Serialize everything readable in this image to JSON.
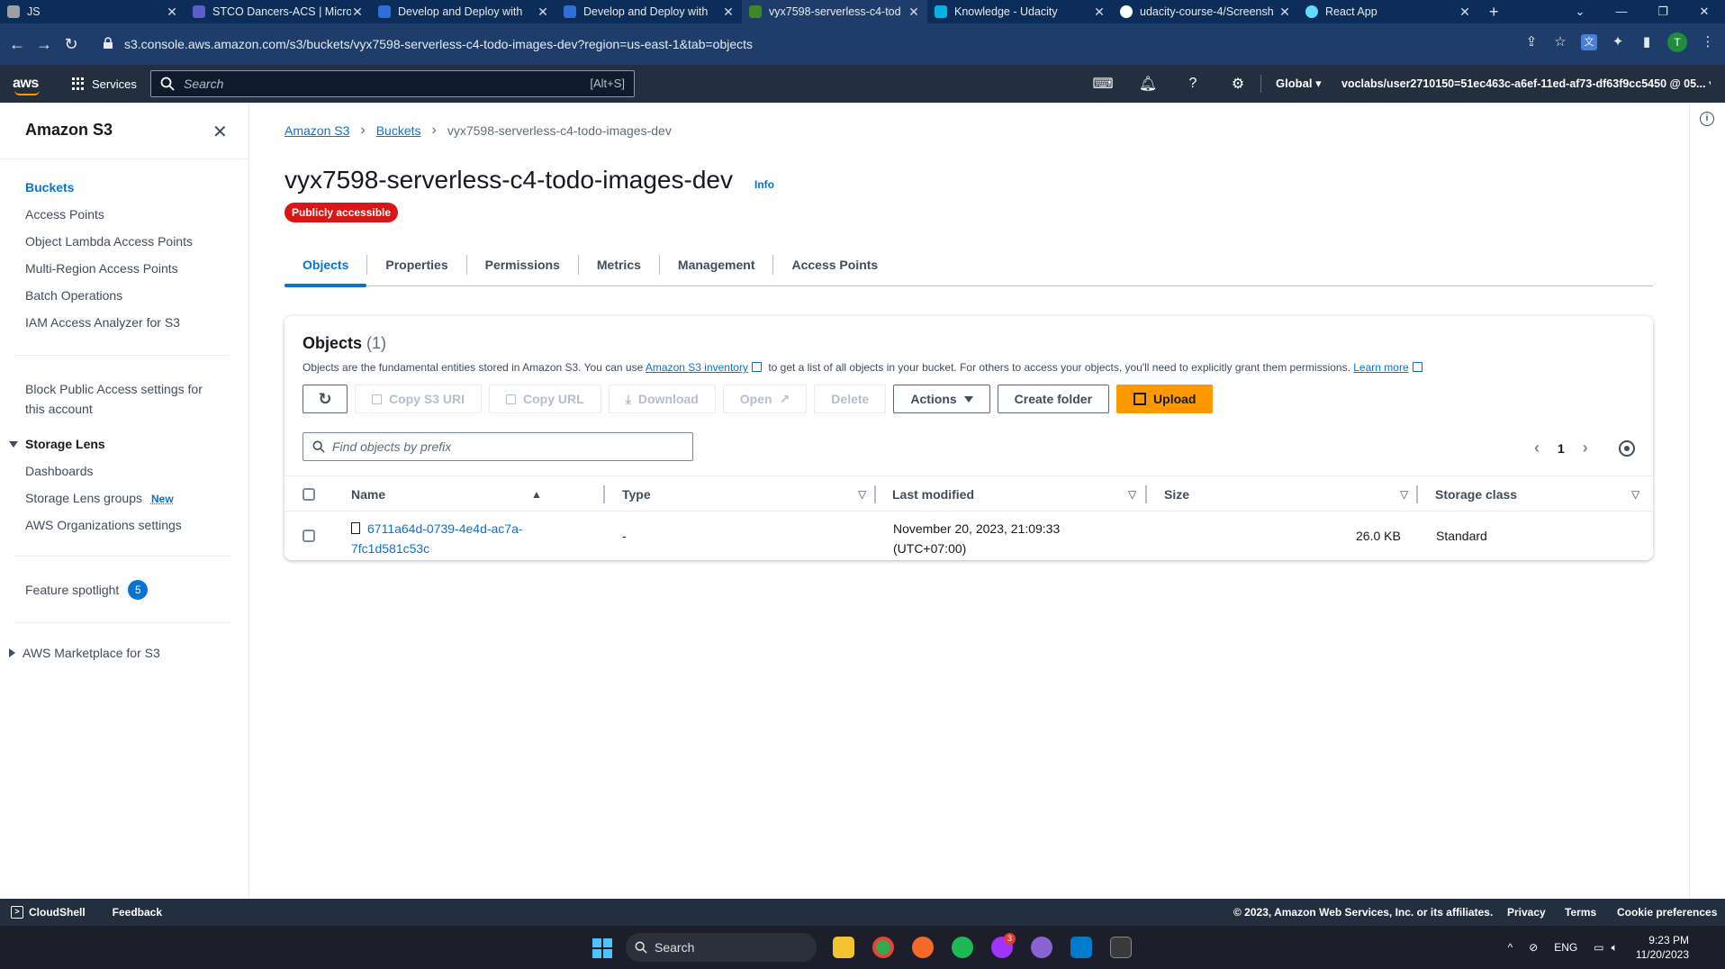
{
  "browser": {
    "tabs": [
      {
        "title": "JS",
        "favicon_color": "#9aa0a6",
        "active": false
      },
      {
        "title": "STCO Dancers-ACS | Micro",
        "favicon_color": "#5b5fc7",
        "active": false
      },
      {
        "title": "Develop and Deploy with",
        "favicon_color": "#2f6fd6",
        "active": false
      },
      {
        "title": "Develop and Deploy with",
        "favicon_color": "#2f6fd6",
        "active": false
      },
      {
        "title": "vyx7598-serverless-c4-tod",
        "favicon_color": "#3f8624",
        "active": true
      },
      {
        "title": "Knowledge - Udacity",
        "favicon_color": "#02b3e4",
        "active": false
      },
      {
        "title": "udacity-course-4/Screensh",
        "favicon_color": "#ffffff",
        "active": false
      },
      {
        "title": "React App",
        "favicon_color": "#61dafb",
        "active": false
      }
    ],
    "url": "s3.console.aws.amazon.com/s3/buckets/vyx7598-serverless-c4-todo-images-dev?region=us-east-1&tab=objects",
    "profile_initial": "T"
  },
  "awsnav": {
    "logo": "aws",
    "services": "Services",
    "search_placeholder": "Search",
    "search_shortcut": "[Alt+S]",
    "region": "Global",
    "account": "voclabs/user2710150=51ec463c-a6ef-11ed-af73-df63f9cc5450 @ 05..."
  },
  "sidebar": {
    "title": "Amazon S3",
    "items": [
      {
        "label": "Buckets",
        "active": true
      },
      {
        "label": "Access Points"
      },
      {
        "label": "Object Lambda Access Points"
      },
      {
        "label": "Multi-Region Access Points"
      },
      {
        "label": "Batch Operations"
      },
      {
        "label": "IAM Access Analyzer for S3"
      }
    ],
    "block_public_line1": "Block Public Access settings for",
    "block_public_line2": "this account",
    "storage_lens": "Storage Lens",
    "storage_lens_items": [
      "Dashboards",
      "Storage Lens groups",
      "AWS Organizations settings"
    ],
    "new_badge": "New",
    "feature_spotlight": "Feature spotlight",
    "feature_spotlight_count": "5",
    "marketplace": "AWS Marketplace for S3"
  },
  "breadcrumb": {
    "root": "Amazon S3",
    "buckets": "Buckets",
    "current": "vyx7598-serverless-c4-todo-images-dev"
  },
  "page": {
    "title": "vyx7598-serverless-c4-todo-images-dev",
    "info": "Info",
    "badge": "Publicly accessible"
  },
  "tabs": [
    "Objects",
    "Properties",
    "Permissions",
    "Metrics",
    "Management",
    "Access Points"
  ],
  "objects_panel": {
    "heading": "Objects",
    "count": "(1)",
    "desc_pre": "Objects are the fundamental entities stored in Amazon S3. You can use ",
    "desc_link": "Amazon S3 inventory",
    "desc_mid": " to get a list of all objects in your bucket. For others to access your objects, you'll need to explicitly grant them permissions. ",
    "desc_learn": "Learn more",
    "buttons": {
      "copy_uri": "Copy S3 URI",
      "copy_url": "Copy URL",
      "download": "Download",
      "open": "Open",
      "delete": "Delete",
      "actions": "Actions",
      "create_folder": "Create folder",
      "upload": "Upload"
    },
    "find_placeholder": "Find objects by prefix",
    "page_number": "1",
    "columns": [
      "Name",
      "Type",
      "Last modified",
      "Size",
      "Storage class"
    ],
    "rows": [
      {
        "name_line1": "6711a64d-0739-4e4d-ac7a-",
        "name_line2": "7fc1d581c53c",
        "type": "-",
        "modified_line1": "November 20, 2023, 21:09:33",
        "modified_line2": "(UTC+07:00)",
        "size": "26.0 KB",
        "storage_class": "Standard"
      }
    ]
  },
  "footer": {
    "cloudshell": "CloudShell",
    "feedback": "Feedback",
    "copyright": "© 2023, Amazon Web Services, Inc. or its affiliates.",
    "privacy": "Privacy",
    "terms": "Terms",
    "cookies": "Cookie preferences"
  },
  "taskbar": {
    "search": "Search",
    "lang": "ENG",
    "time": "9:23 PM",
    "date": "11/20/2023",
    "messenger_badge": "3"
  },
  "colors": {
    "aws_nav": "#232f3e",
    "link": "#0972d3",
    "upload": "#ff9900",
    "danger_badge": "#d91515"
  }
}
